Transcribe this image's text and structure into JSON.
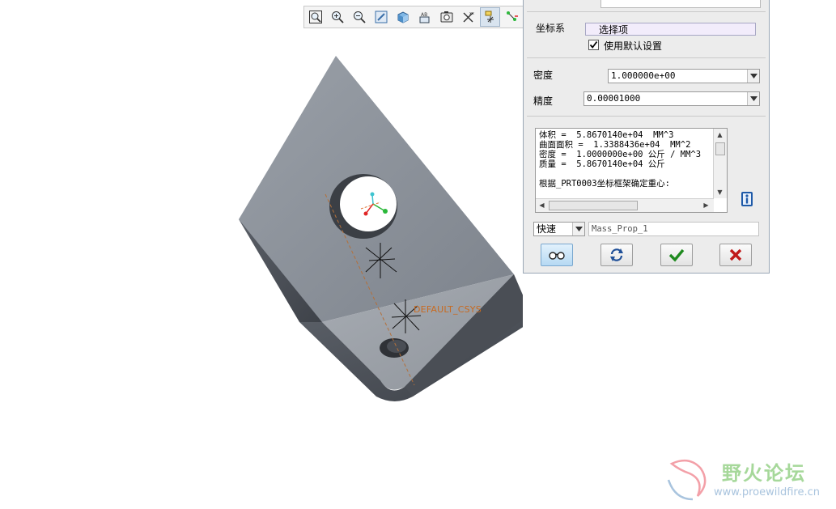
{
  "toolbar": {
    "buttons": [
      {
        "name": "zoom-fit",
        "icon": "refit-icon"
      },
      {
        "name": "zoom-in",
        "icon": "zoom-in-icon"
      },
      {
        "name": "zoom-out",
        "icon": "zoom-out-icon"
      },
      {
        "name": "repaint",
        "icon": "repaint-icon"
      },
      {
        "name": "display-style",
        "icon": "shaded-cube-icon"
      },
      {
        "name": "named-view",
        "icon": "named-view-icon"
      },
      {
        "name": "view-manager",
        "icon": "view-manager-icon"
      },
      {
        "name": "annotation-display",
        "icon": "annotation-icon"
      },
      {
        "name": "datum-display",
        "icon": "datum-display-icon"
      },
      {
        "name": "spin-center",
        "icon": "spin-center-icon"
      }
    ],
    "active_button": "datum-display"
  },
  "viewport": {
    "csys_label": "DEFAULT_CSYS",
    "colors": {
      "top_face": "#8a9099",
      "side_face": "#4c5058",
      "accent_label": "#c86a20"
    }
  },
  "dialog": {
    "csys_label": "坐标系",
    "csys_value": "选择项",
    "use_default_label": "使用默认设置",
    "use_default_checked": true,
    "density_label": "密度",
    "density_value": "1.000000e+00",
    "precision_label": "精度",
    "precision_value": "0.00001000",
    "results_text": "体积 =  5.8670140e+04  MM^3\n曲面面积 =  1.3388436e+04  MM^2\n密度 =  1.0000000e+00 公斤 / MM^3\n质量 =  5.8670140e+04 公斤\n\n根据_PRT0003坐标框架确定重心:",
    "mode_value": "快速",
    "feature_name": "Mass_Prop_1",
    "buttons": {
      "preview": "preview-glasses-icon",
      "repeat": "repeat-arrows-icon",
      "ok": "checkmark-icon",
      "cancel": "cancel-x-icon"
    },
    "colors": {
      "ok": "#1f8a1f",
      "cancel": "#c01a1a",
      "info": "#1f5aa8"
    }
  },
  "watermark": {
    "title": "野火论坛",
    "url": "www.proewildfire.cn"
  }
}
